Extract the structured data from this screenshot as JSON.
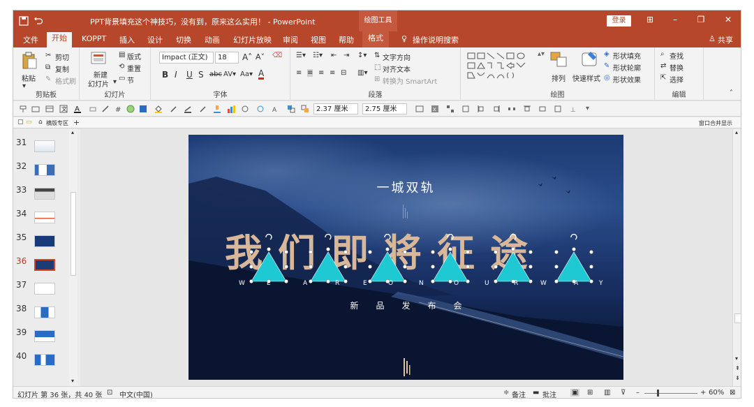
{
  "window": {
    "title": "PPT背景填充这个神技巧，没有到，原来这么实用！ - PowerPoint",
    "context_tab_group": "绘图工具",
    "login_label": "登录"
  },
  "tabs": [
    {
      "label": "文件"
    },
    {
      "label": "开始",
      "active": true
    },
    {
      "label": "KOPPT"
    },
    {
      "label": "插入"
    },
    {
      "label": "设计"
    },
    {
      "label": "切换"
    },
    {
      "label": "动画"
    },
    {
      "label": "幻灯片放映"
    },
    {
      "label": "审阅"
    },
    {
      "label": "视图"
    },
    {
      "label": "帮助"
    },
    {
      "label": "格式"
    }
  ],
  "tell_me": "操作说明搜索",
  "share": "共享",
  "ribbon": {
    "clipboard": {
      "label": "剪贴板",
      "paste": "粘贴",
      "cut": "剪切",
      "copy": "复制",
      "format_painter": "格式刷"
    },
    "slides": {
      "label": "幻灯片",
      "new_slide": "新建",
      "new_slide2": "幻灯片",
      "layout": "版式",
      "reset": "重置",
      "section": "节"
    },
    "font": {
      "label": "字体",
      "font_name": "Impact (正文)",
      "font_size": "18"
    },
    "paragraph": {
      "label": "段落",
      "text_direction": "文字方向",
      "align_text": "对齐文本",
      "smartart": "转换为 SmartArt"
    },
    "drawing": {
      "label": "绘图",
      "arrange": "排列",
      "quick_styles": "快速样式",
      "shape_fill": "形状填充",
      "shape_outline": "形状轮廓",
      "shape_effects": "形状效果"
    },
    "editing": {
      "label": "编辑",
      "find": "查找",
      "replace": "替换",
      "select": "选择"
    }
  },
  "qat": {
    "width": "2.37 厘米",
    "height": "2.75 厘米"
  },
  "strip": {
    "tab1": "横版专区",
    "right": "窗口合并显示"
  },
  "thumbnails": [
    {
      "num": "31"
    },
    {
      "num": "32"
    },
    {
      "num": "33"
    },
    {
      "num": "34"
    },
    {
      "num": "35"
    },
    {
      "num": "36",
      "selected": true
    },
    {
      "num": "37"
    },
    {
      "num": "38"
    },
    {
      "num": "39"
    },
    {
      "num": "40"
    }
  ],
  "slide": {
    "subtitle": "一城双轨",
    "headline": "我们即将征途",
    "english": [
      "W",
      "E",
      "A",
      "R",
      "E",
      "O",
      "N",
      "O",
      "U",
      "R",
      "W",
      "A",
      "Y"
    ],
    "tagline": "新品发布会"
  },
  "status": {
    "slide_info": "幻灯片 第 36 张，共 40 张",
    "language": "中文(中国)",
    "notes": "备注",
    "comments": "批注",
    "zoom": "60%"
  },
  "colors": {
    "accent": "#b7472a",
    "triangle": "#1ec9d4",
    "headline": "#d9b89a"
  }
}
